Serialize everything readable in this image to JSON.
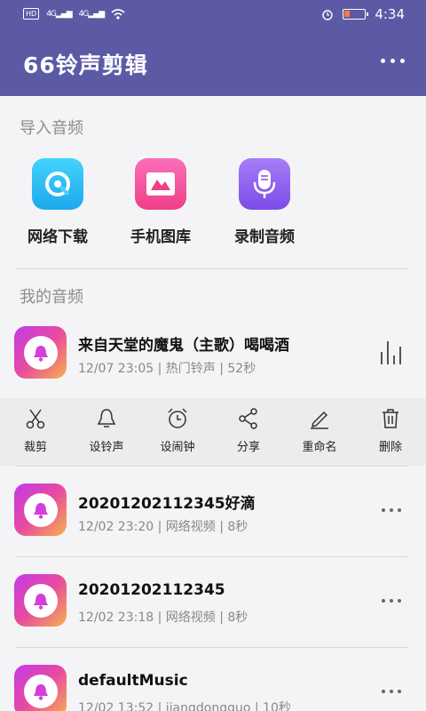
{
  "status": {
    "left": "HD",
    "net1": "4G",
    "net2": "4G",
    "time": "4:34"
  },
  "header": {
    "title": "66铃声剪辑"
  },
  "import": {
    "label": "导入音频",
    "items": [
      {
        "label": "网络下载",
        "icon": "network-download-icon",
        "color": "#2ec0f5"
      },
      {
        "label": "手机图库",
        "icon": "gallery-icon",
        "color": "#f0509a"
      },
      {
        "label": "录制音频",
        "icon": "microphone-icon",
        "color": "#8b5cf0"
      }
    ]
  },
  "my_audio": {
    "label": "我的音频",
    "items": [
      {
        "title": "来自天堂的魔鬼（主歌）喝喝酒",
        "meta": "12/07 23:05 | 热门铃声 | 52秒"
      },
      {
        "title": "20201202112345好滴",
        "meta": "12/02 23:20 | 网络视频 | 8秒"
      },
      {
        "title": "20201202112345",
        "meta": "12/02 23:18 | 网络视频 | 8秒"
      },
      {
        "title": "defaultMusic",
        "meta": "12/02 13:52 | jiangdongguo | 10秒"
      }
    ]
  },
  "actions": {
    "items": [
      {
        "label": "裁剪",
        "icon": "scissors-icon"
      },
      {
        "label": "设铃声",
        "icon": "bell-icon"
      },
      {
        "label": "设闹钟",
        "icon": "alarm-clock-icon"
      },
      {
        "label": "分享",
        "icon": "share-icon"
      },
      {
        "label": "重命名",
        "icon": "rename-icon"
      },
      {
        "label": "删除",
        "icon": "trash-icon"
      }
    ]
  }
}
